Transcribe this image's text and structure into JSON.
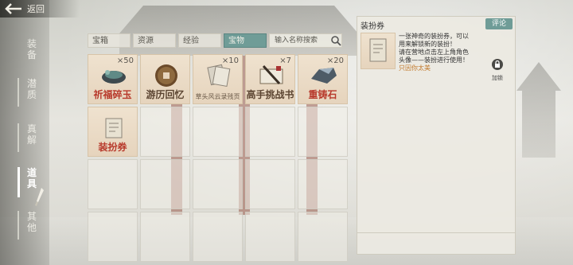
{
  "back_label": "返回",
  "sidebar": {
    "items": [
      {
        "label": "装备",
        "active": false
      },
      {
        "label": "潜质",
        "active": false
      },
      {
        "label": "真解",
        "active": false
      },
      {
        "label": "道具",
        "active": true
      },
      {
        "label": "其他",
        "active": false
      }
    ]
  },
  "tabs": [
    "宝箱",
    "资源",
    "经验",
    "宝物"
  ],
  "active_tab": "宝物",
  "search": {
    "placeholder": "输入名称搜索"
  },
  "items": [
    {
      "name": "祈福碎玉",
      "qty": "×50"
    },
    {
      "name": "游历回忆",
      "qty": ""
    },
    {
      "name": "草头风云录残页",
      "qty": "×10"
    },
    {
      "name": "高手挑战书",
      "qty": "×7"
    },
    {
      "name": "重铸石",
      "qty": "×20"
    },
    {
      "name": "装扮券",
      "qty": ""
    }
  ],
  "detail": {
    "title": "装扮券",
    "comment_label": "评论",
    "desc_lines": [
      "一张神奇的装扮券，可以",
      "用来解锁新的装扮！",
      "请在营地点击左上角角色",
      "头像——装扮进行使用！"
    ],
    "source": "只因你太美",
    "lock_label": "加锁"
  },
  "colors": {
    "accent_tab": "#6f9c97",
    "item_name_red": "#b83a2c",
    "source_orange": "#c27a2e"
  }
}
